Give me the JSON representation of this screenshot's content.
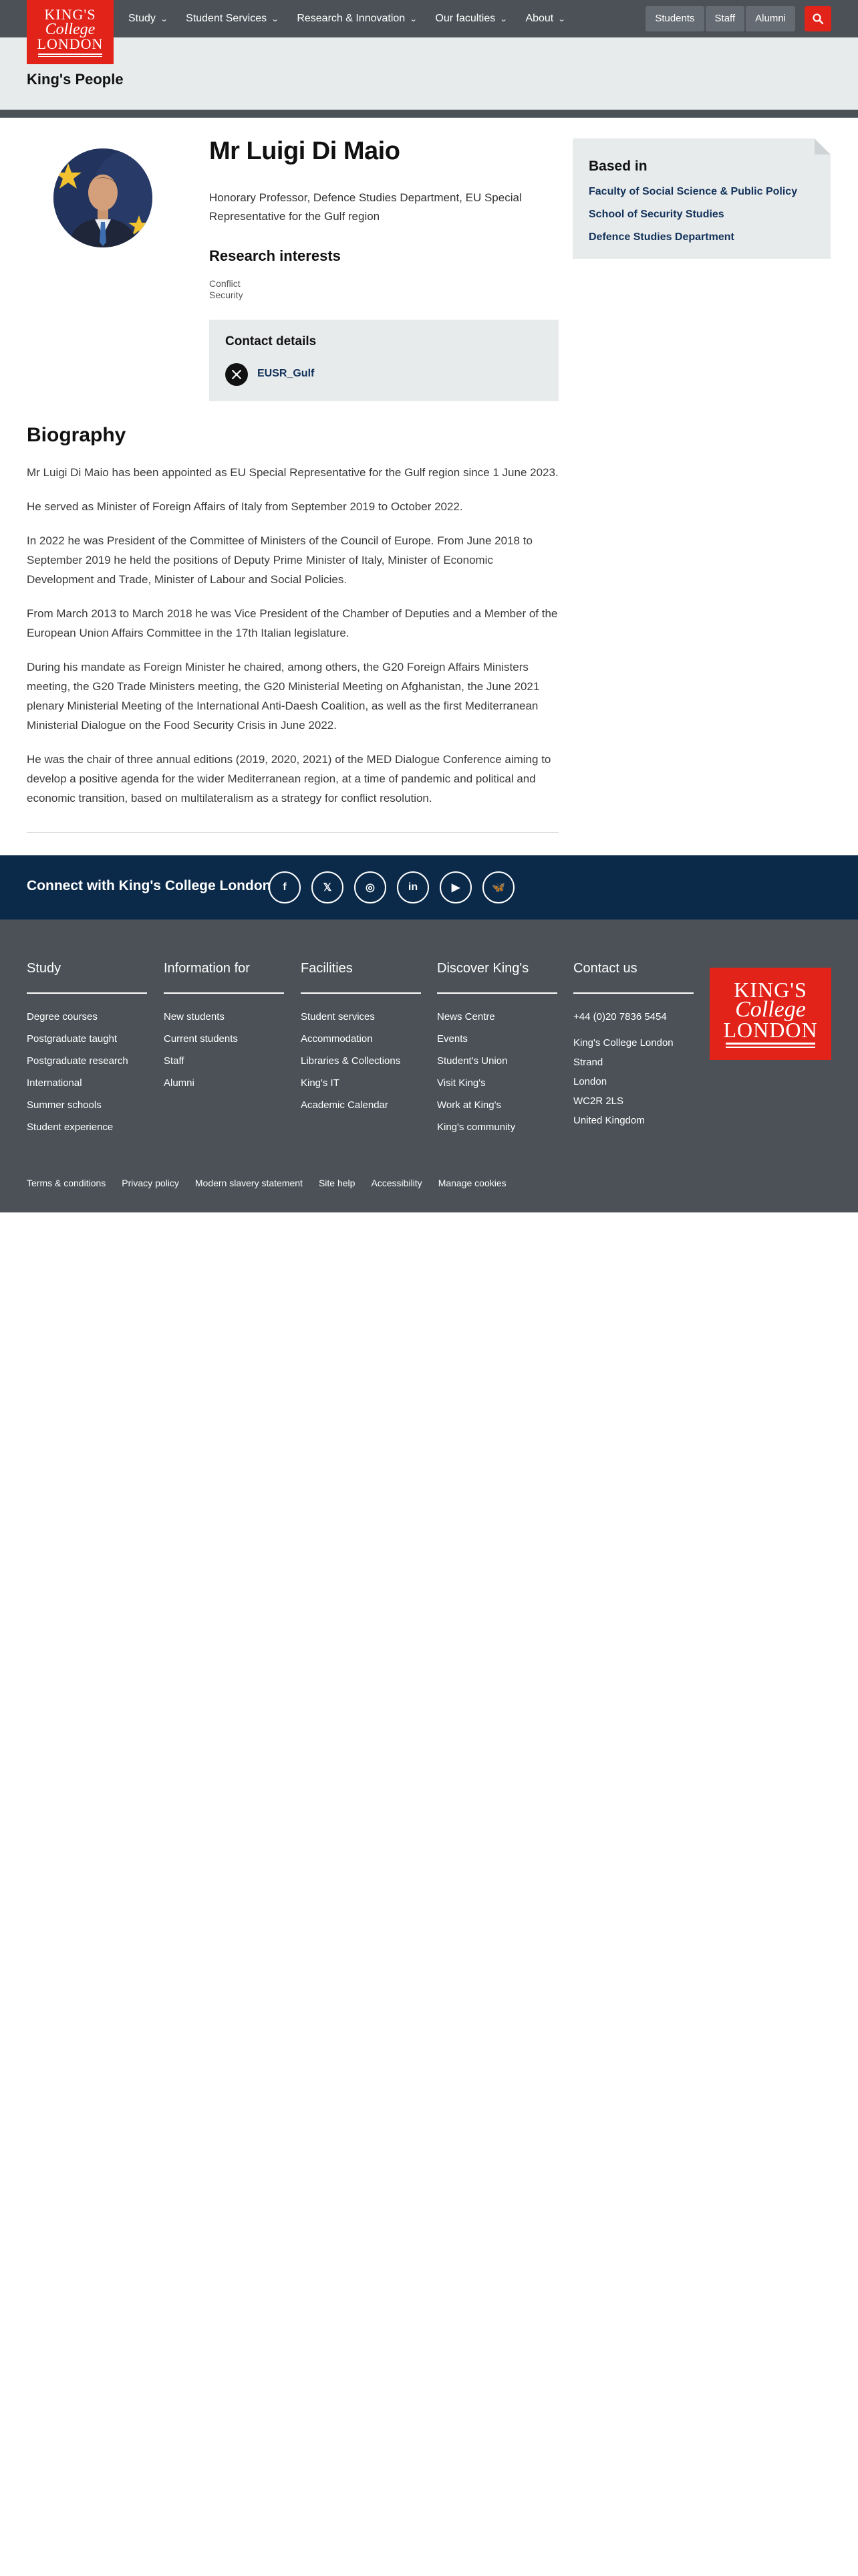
{
  "brand": {
    "logo_line1": "KING'S",
    "logo_line2": "College",
    "logo_line3": "LONDON",
    "red": "#e2231a",
    "navy": "#0b2a4a",
    "slate": "#4b5157"
  },
  "nav": {
    "items": [
      {
        "label": "Study"
      },
      {
        "label": "Student Services"
      },
      {
        "label": "Research & Innovation"
      },
      {
        "label": "Our faculties"
      },
      {
        "label": "About"
      }
    ],
    "audience": [
      "Students",
      "Staff",
      "Alumni"
    ],
    "search_icon": "search-icon"
  },
  "section": {
    "title": "King's People"
  },
  "profile": {
    "name": "Mr Luigi Di Maio",
    "role": "Honorary Professor, Defence Studies Department, EU Special Representative for the Gulf region",
    "research_heading": "Research interests",
    "research_interests": [
      "Conflict",
      "Security"
    ],
    "contact_heading": "Contact details",
    "contact_handle": "EUSR_Gulf",
    "contact_icon": "x-twitter-icon"
  },
  "based_in": {
    "heading": "Based in",
    "links": [
      "Faculty of Social Science & Public Policy",
      "School of Security Studies",
      "Defence Studies Department"
    ]
  },
  "biography": {
    "heading": "Biography",
    "paragraphs": [
      "Mr Luigi Di Maio has been appointed as EU Special Representative for the Gulf region since 1 June 2023.",
      "He served as Minister of Foreign Affairs of Italy from September 2019 to October 2022.",
      "In 2022 he was President of the Committee of Ministers of the Council of Europe. From June 2018 to September 2019 he held the positions of Deputy Prime Minister of Italy, Minister of Economic Development and Trade, Minister of Labour and Social Policies.",
      "From March 2013 to March 2018 he was Vice President of the Chamber of Deputies and a Member of the European Union Affairs Committee in the 17th Italian legislature.",
      "During his mandate as Foreign Minister he chaired, among others, the G20 Foreign Affairs Ministers meeting, the G20 Trade Ministers meeting, the G20 Ministerial Meeting on Afghanistan, the June 2021 plenary Ministerial Meeting of the International Anti-Daesh Coalition, as well as the first Mediterranean Ministerial Dialogue on the Food Security Crisis in June 2022.",
      "He was the chair of three annual editions (2019, 2020, 2021) of the MED Dialogue Conference aiming to develop a positive agenda for the wider Mediterranean region, at a time of pandemic and political and economic transition, based on multilateralism as a strategy for conflict resolution."
    ]
  },
  "connect": {
    "title": "Connect with King's College London",
    "socials": [
      {
        "name": "facebook-icon",
        "glyph": "f"
      },
      {
        "name": "x-icon",
        "glyph": "𝕏"
      },
      {
        "name": "instagram-icon",
        "glyph": "◎"
      },
      {
        "name": "linkedin-icon",
        "glyph": "in"
      },
      {
        "name": "youtube-icon",
        "glyph": "▶"
      },
      {
        "name": "bluesky-icon",
        "glyph": "🦋"
      }
    ]
  },
  "footer": {
    "columns": [
      {
        "heading": "Study",
        "links": [
          "Degree courses",
          "Postgraduate taught",
          "Postgraduate research",
          "International",
          "Summer schools",
          "Student experience"
        ]
      },
      {
        "heading": "Information for",
        "links": [
          "New students",
          "Current students",
          "Staff",
          "Alumni"
        ]
      },
      {
        "heading": "Facilities",
        "links": [
          "Student services",
          "Accommodation",
          "Libraries & Collections",
          "King's IT",
          "Academic Calendar"
        ]
      },
      {
        "heading": "Discover King's",
        "links": [
          "News Centre",
          "Events",
          "Student's Union",
          "Visit King's",
          "Work at King's",
          "King's community"
        ]
      }
    ],
    "contact": {
      "heading": "Contact us",
      "phone": "+44 (0)20 7836 5454",
      "address": [
        "King's College London",
        "Strand",
        "London",
        "WC2R 2LS",
        "United Kingdom"
      ]
    },
    "legal": [
      "Terms & conditions",
      "Privacy policy",
      "Modern slavery statement",
      "Site help",
      "Accessibility",
      "Manage cookies"
    ]
  }
}
